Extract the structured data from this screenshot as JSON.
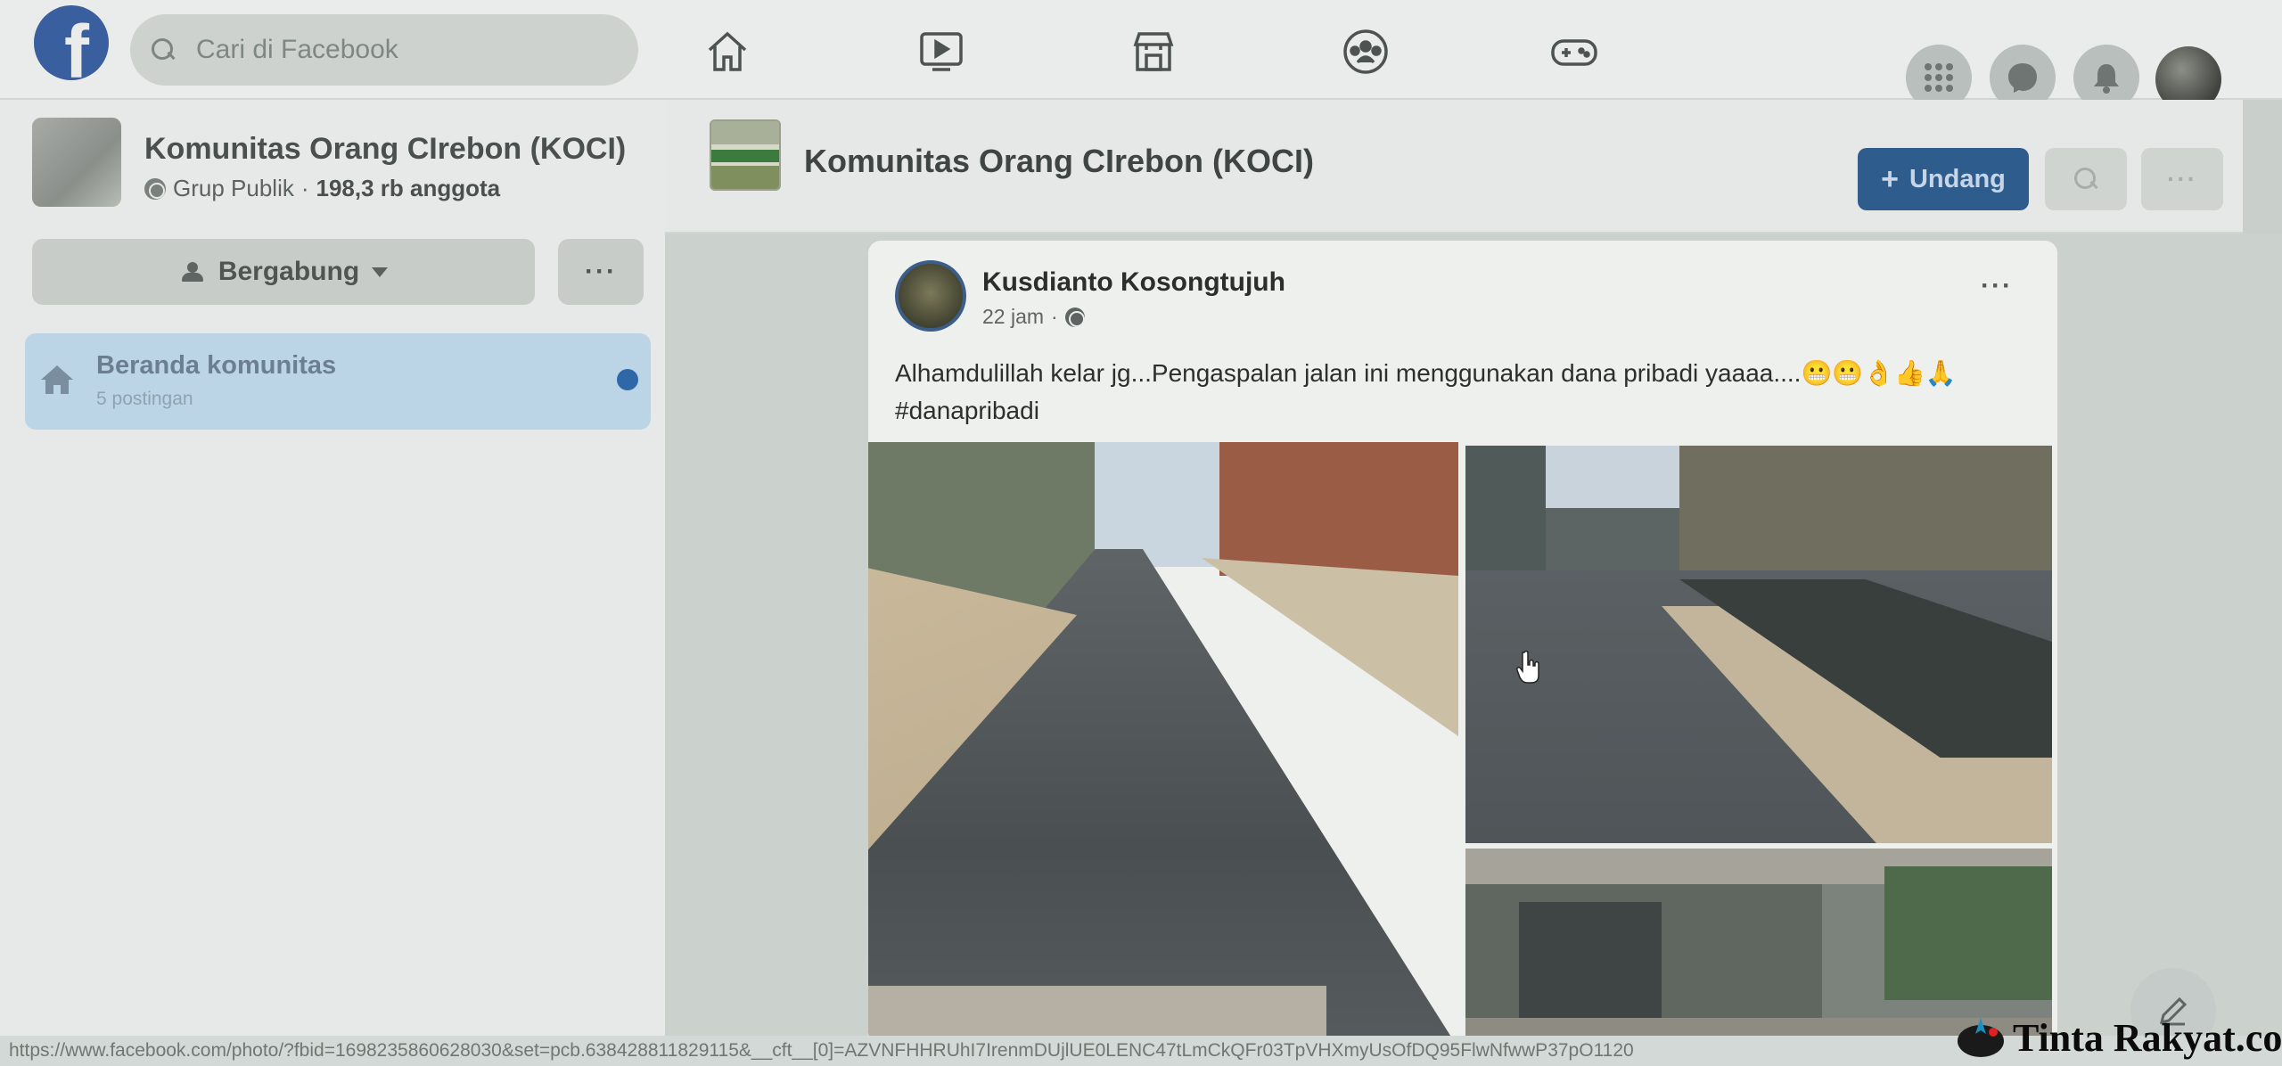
{
  "nav": {
    "search_placeholder": "Cari di Facebook",
    "icons": [
      "home-icon",
      "video-icon",
      "marketplace-icon",
      "groups-icon",
      "gaming-icon"
    ],
    "right_icons": [
      "menu-grid-icon",
      "messenger-icon",
      "notifications-icon",
      "profile-avatar"
    ]
  },
  "sidebar": {
    "group_name": "Komunitas Orang CIrebon (KOCI)",
    "group_type": "Grup Publik",
    "member_count": "198,3 rb anggota",
    "join_label": "Bergabung",
    "more_label": "···",
    "home_item": {
      "label": "Beranda komunitas",
      "sub": "5 postingan"
    }
  },
  "main_header": {
    "title": "Komunitas Orang CIrebon (KOCI)",
    "invite_label": "Undang",
    "more_label": "···"
  },
  "post": {
    "author": "Kusdianto Kosongtujuh",
    "time": "22 jam",
    "separator": "·",
    "text": "Alhamdulillah kelar jg...Pengaspalan jalan ini menggunakan dana pribadi yaaaa....😬😬👌👍🙏",
    "hashtag": "#danapribadi",
    "menu_label": "···"
  },
  "status_bar": {
    "url": "https://www.facebook.com/photo/?fbid=1698235860628030&set=pcb.638428811829115&__cft__[0]=AZVNFHHRUhI7IrenmDUjlUE0LENC47tLmCkQFr03TpVHXmyUsOfDQ95FlwNfwwP37pO1120"
  },
  "watermark": {
    "text": "Tinta Rakyat.com"
  },
  "colors": {
    "brand_blue": "#2e5c8c",
    "unread_dot": "#2f68a8",
    "selected_item_bg": "#bcd5e6"
  }
}
